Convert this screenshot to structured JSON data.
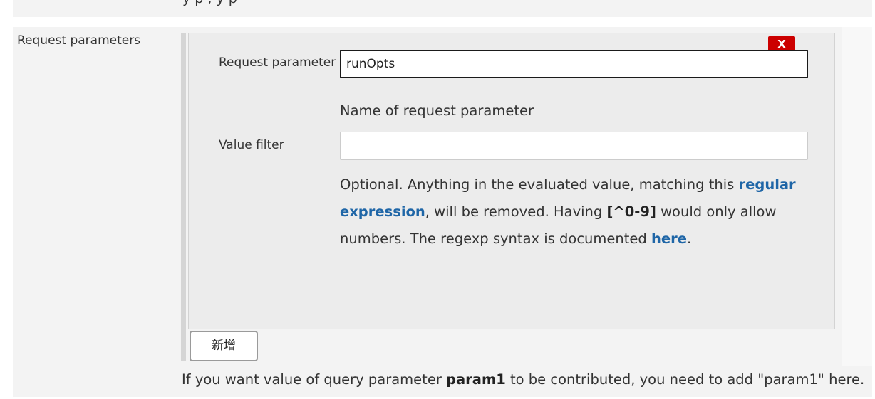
{
  "top_partial_text": "y                                    p                                              ,  y                                   p",
  "section": {
    "label": "Request parameters"
  },
  "parameter": {
    "delete_label": "X",
    "request_parameter_label": "Request parameter",
    "request_parameter_value": "runOpts",
    "request_parameter_help": "Name of request parameter",
    "value_filter_label": "Value filter",
    "value_filter_value": "",
    "value_filter_help": {
      "part1": "Optional. Anything in the evaluated value, matching this ",
      "link1": "regular expression",
      "part2": ", will be removed. Having ",
      "code": "[^0-9]",
      "part3": " would only allow numbers. The regexp syntax is documented ",
      "link2": "here",
      "part4": "."
    }
  },
  "add_button_label": "新增",
  "footer_help": {
    "part1": "If you want value of query parameter ",
    "bold": "param1",
    "part2": " to be contributed, you need to add \"param1\" here."
  },
  "colors": {
    "delete_red": "#cc0000",
    "link_blue": "#1f66a7",
    "chunk_bg": "#ececec"
  }
}
